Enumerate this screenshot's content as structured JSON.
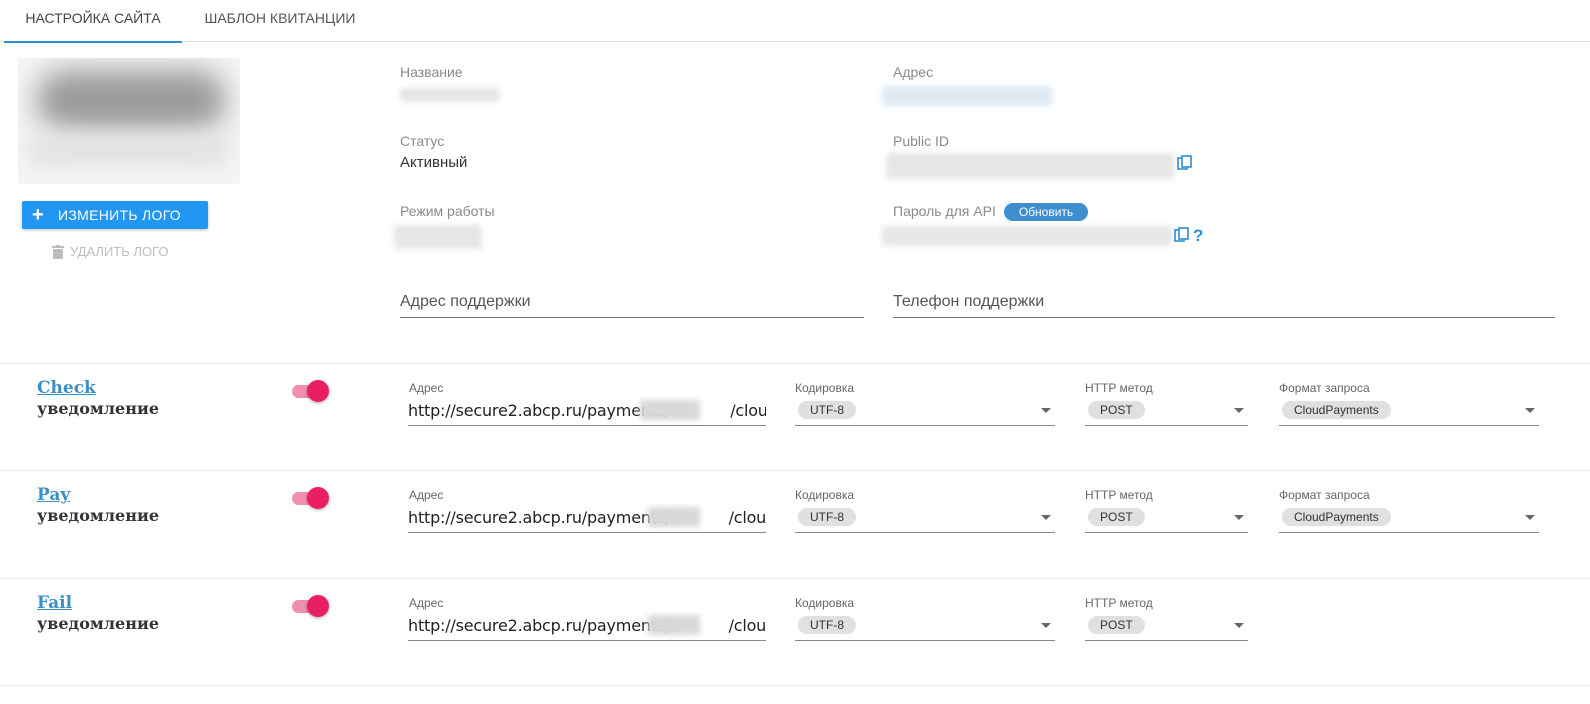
{
  "tabs": [
    {
      "label": "НАСТРОЙКА САЙТА",
      "active": true
    },
    {
      "label": "ШАБЛОН КВИТАНЦИИ",
      "active": false
    }
  ],
  "colors": {
    "accent": "#2c8fd1",
    "primary_button": "#2196f3",
    "toggle_on": "#e91e63",
    "link": "#3a8fc4"
  },
  "logo": {
    "change_label": "ИЗМЕНИТЬ ЛОГО",
    "change_icon": "plus-icon",
    "delete_label": "УДАЛИТЬ ЛОГО",
    "delete_icon": "trash-icon"
  },
  "site": {
    "name_label": "Название",
    "address_label": "Адрес",
    "status_label": "Статус",
    "status_value": "Активный",
    "public_id_label": "Public ID",
    "mode_label": "Режим работы",
    "api_password_label": "Пароль для API",
    "refresh_label": "Обновить",
    "support_address_placeholder": "Адрес поддержки",
    "support_phone_placeholder": "Телефон поддержки"
  },
  "notifications": [
    {
      "name": "Check",
      "subtitle": "уведомление",
      "enabled": true,
      "address_label": "Адрес",
      "address_prefix": "http://secure2.abcp.ru/payments/",
      "address_suffix": "/cloudPayments",
      "encoding_label": "Кодировка",
      "encoding": "UTF-8",
      "method_label": "HTTP метод",
      "method": "POST",
      "format_label": "Формат запроса",
      "format": "CloudPayments"
    },
    {
      "name": "Pay",
      "subtitle": "уведомление",
      "enabled": true,
      "address_label": "Адрес",
      "address_prefix": "http://secure2.abcp.ru/payments/r",
      "address_suffix": "/cloudPayments",
      "encoding_label": "Кодировка",
      "encoding": "UTF-8",
      "method_label": "HTTP метод",
      "method": "POST",
      "format_label": "Формат запроса",
      "format": "CloudPayments"
    },
    {
      "name": "Fail",
      "subtitle": "уведомление",
      "enabled": true,
      "address_label": "Адрес",
      "address_prefix": "http://secure2.abcp.ru/payments/r",
      "address_suffix": "/cloudPayments",
      "encoding_label": "Кодировка",
      "encoding": "UTF-8",
      "method_label": "HTTP метод",
      "method": "POST"
    }
  ]
}
